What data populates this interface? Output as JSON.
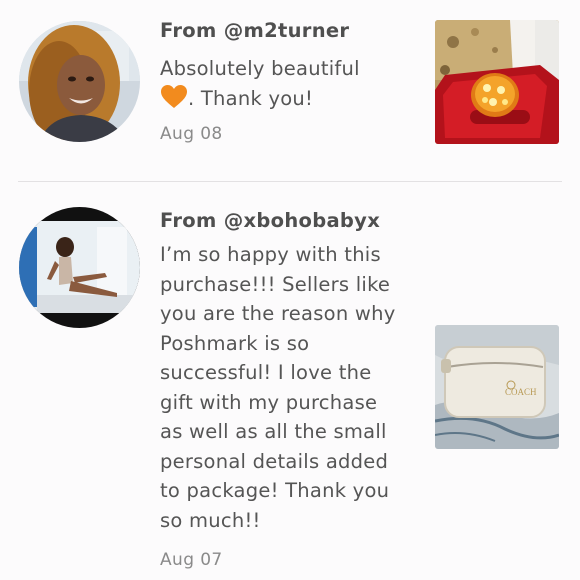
{
  "reviews": [
    {
      "from": "From @m2turner",
      "message_before": "Absolutely beautiful",
      "emoji": "orange-heart",
      "message_after": ". Thank you!",
      "date": "Aug 08",
      "thumb_icon": "ring-in-box-photo"
    },
    {
      "from": "From @xbohobabyx",
      "message_lines": [
        "I’m so happy with this",
        "purchase!!! Sellers like",
        "you are the reason why",
        "Poshmark is so",
        "successful! I love the",
        "gift with my purchase",
        "as well as all the small",
        "personal details added",
        "to package! Thank you",
        "so much!!"
      ],
      "date": "Aug 07",
      "thumb_icon": "white-zip-case-photo"
    }
  ],
  "colors": {
    "background": "#fcfbfc",
    "text": "#555555",
    "date": "#8a8a8a",
    "divider": "#e3e1e3",
    "heart": "#f28b1e"
  }
}
